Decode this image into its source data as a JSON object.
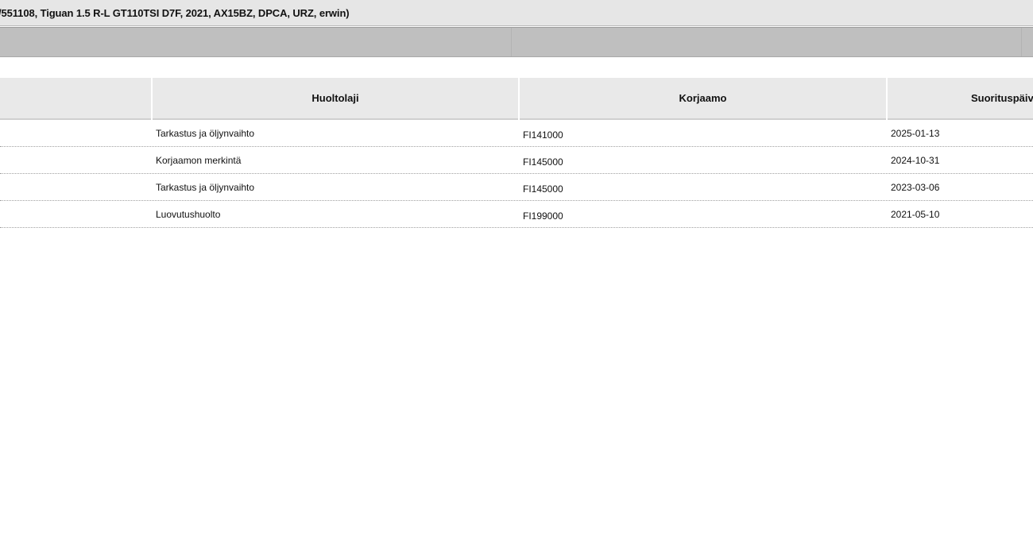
{
  "window": {
    "title": "/551108, Tiguan 1.5 R-L GT110TSI D7F, 2021, AX15BZ, DPCA, URZ, erwin)"
  },
  "table": {
    "headers": [
      "",
      "Huoltolaji",
      "Korjaamo",
      "Suorituspäiv"
    ],
    "rows": [
      {
        "col0": "",
        "service_type": "Tarkastus ja öljynvaihto",
        "workshop": "FI141000",
        "date": "2025-01-13"
      },
      {
        "col0": "",
        "service_type": "Korjaamon merkintä",
        "workshop": "FI145000",
        "date": "2024-10-31"
      },
      {
        "col0": "",
        "service_type": "Tarkastus ja öljynvaihto",
        "workshop": "FI145000",
        "date": "2023-03-06"
      },
      {
        "col0": "",
        "service_type": "Luovutushuolto",
        "workshop": "FI199000",
        "date": "2021-05-10"
      }
    ]
  }
}
